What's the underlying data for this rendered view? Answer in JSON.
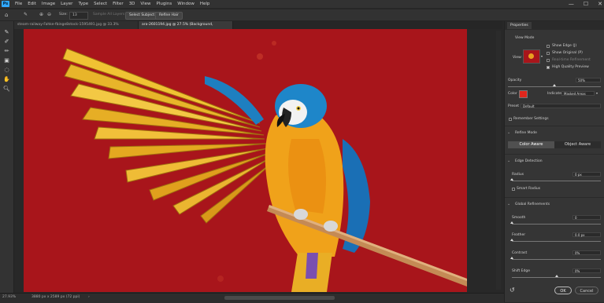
{
  "menu": {
    "logo": "Ps",
    "items": [
      "File",
      "Edit",
      "Image",
      "Layer",
      "Type",
      "Select",
      "Filter",
      "3D",
      "View",
      "Plugins",
      "Window",
      "Help"
    ]
  },
  "window_controls": {
    "minimize": "—",
    "maximize": "☐",
    "close": "✕"
  },
  "options": {
    "size_label": "Size:",
    "size_value": "13",
    "sample_all_layers": "Sample All Layers",
    "select_subject": "Select Subject",
    "refine_hair": "Refine Hair"
  },
  "tabs": [
    {
      "label": "steam-railway-Fahke-fbinge8stock-1595491.jpg @ 33.3% (RGB/8#)",
      "close": "×"
    },
    {
      "label": "ara-2601194.jpg @ 27.5% (Background, RGB/8#)",
      "close": "×"
    }
  ],
  "status": {
    "zoom": "27.93%",
    "doc_size": "3880 px x 2589 px (72 ppi)",
    "arrow": "›"
  },
  "panel": {
    "tab": "Properties",
    "view_mode": "View Mode",
    "view_label": "View:",
    "show_edge": "Show Edge (J)",
    "show_original": "Show Original (P)",
    "realtime_refinement": "Real-time Refinement",
    "high_quality_preview": "High Quality Preview",
    "opacity_label": "Opacity",
    "opacity_value": "50%",
    "color_label": "Color",
    "color_value": "#e0261c",
    "indicates_label": "Indicates",
    "indicates_value": "Masked Areas",
    "preset_label": "Preset",
    "preset_value": "Default",
    "remember_settings": "Remember Settings",
    "refine_mode": "Refine Mode",
    "color_aware": "Color Aware",
    "object_aware": "Object Aware",
    "edge_detection": "Edge Detection",
    "radius_label": "Radius",
    "radius_value": "0 px",
    "smart_radius": "Smart Radius",
    "global_refinements": "Global Refinements",
    "smooth_label": "Smooth",
    "smooth_value": "0",
    "feather_label": "Feather",
    "feather_value": "0.0 px",
    "contrast_label": "Contrast",
    "contrast_value": "0%",
    "shift_edge_label": "Shift Edge",
    "shift_edge_value": "0%",
    "ok": "OK",
    "cancel": "Cancel",
    "opacity_level": 0.5,
    "shift_edge_level": 0.5
  },
  "colors": {
    "canvas_red": "#a8151b",
    "accent": "#31a8ff"
  }
}
